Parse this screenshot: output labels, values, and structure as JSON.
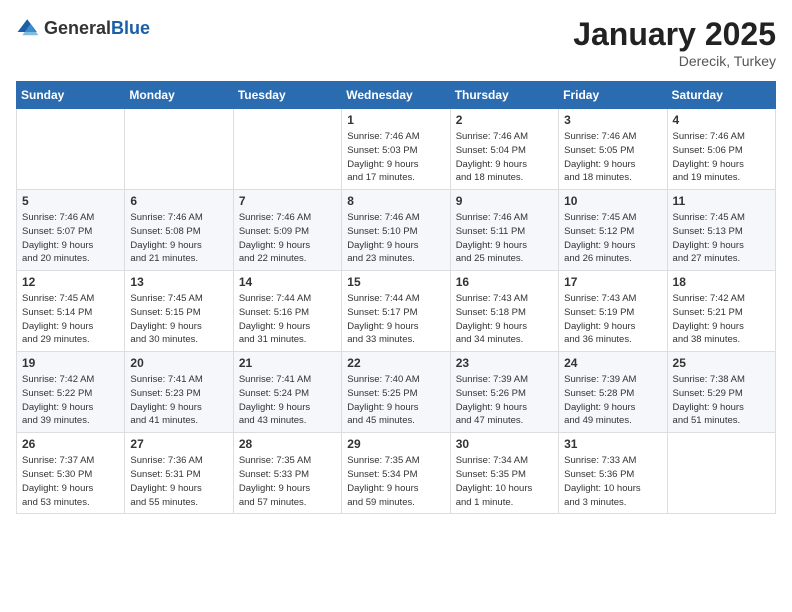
{
  "header": {
    "logo": {
      "general": "General",
      "blue": "Blue"
    },
    "title": "January 2025",
    "location": "Derecik, Turkey"
  },
  "calendar": {
    "weekdays": [
      "Sunday",
      "Monday",
      "Tuesday",
      "Wednesday",
      "Thursday",
      "Friday",
      "Saturday"
    ],
    "weeks": [
      [
        {
          "day": null,
          "info": null
        },
        {
          "day": null,
          "info": null
        },
        {
          "day": null,
          "info": null
        },
        {
          "day": "1",
          "info": "Sunrise: 7:46 AM\nSunset: 5:03 PM\nDaylight: 9 hours\nand 17 minutes."
        },
        {
          "day": "2",
          "info": "Sunrise: 7:46 AM\nSunset: 5:04 PM\nDaylight: 9 hours\nand 18 minutes."
        },
        {
          "day": "3",
          "info": "Sunrise: 7:46 AM\nSunset: 5:05 PM\nDaylight: 9 hours\nand 18 minutes."
        },
        {
          "day": "4",
          "info": "Sunrise: 7:46 AM\nSunset: 5:06 PM\nDaylight: 9 hours\nand 19 minutes."
        }
      ],
      [
        {
          "day": "5",
          "info": "Sunrise: 7:46 AM\nSunset: 5:07 PM\nDaylight: 9 hours\nand 20 minutes."
        },
        {
          "day": "6",
          "info": "Sunrise: 7:46 AM\nSunset: 5:08 PM\nDaylight: 9 hours\nand 21 minutes."
        },
        {
          "day": "7",
          "info": "Sunrise: 7:46 AM\nSunset: 5:09 PM\nDaylight: 9 hours\nand 22 minutes."
        },
        {
          "day": "8",
          "info": "Sunrise: 7:46 AM\nSunset: 5:10 PM\nDaylight: 9 hours\nand 23 minutes."
        },
        {
          "day": "9",
          "info": "Sunrise: 7:46 AM\nSunset: 5:11 PM\nDaylight: 9 hours\nand 25 minutes."
        },
        {
          "day": "10",
          "info": "Sunrise: 7:45 AM\nSunset: 5:12 PM\nDaylight: 9 hours\nand 26 minutes."
        },
        {
          "day": "11",
          "info": "Sunrise: 7:45 AM\nSunset: 5:13 PM\nDaylight: 9 hours\nand 27 minutes."
        }
      ],
      [
        {
          "day": "12",
          "info": "Sunrise: 7:45 AM\nSunset: 5:14 PM\nDaylight: 9 hours\nand 29 minutes."
        },
        {
          "day": "13",
          "info": "Sunrise: 7:45 AM\nSunset: 5:15 PM\nDaylight: 9 hours\nand 30 minutes."
        },
        {
          "day": "14",
          "info": "Sunrise: 7:44 AM\nSunset: 5:16 PM\nDaylight: 9 hours\nand 31 minutes."
        },
        {
          "day": "15",
          "info": "Sunrise: 7:44 AM\nSunset: 5:17 PM\nDaylight: 9 hours\nand 33 minutes."
        },
        {
          "day": "16",
          "info": "Sunrise: 7:43 AM\nSunset: 5:18 PM\nDaylight: 9 hours\nand 34 minutes."
        },
        {
          "day": "17",
          "info": "Sunrise: 7:43 AM\nSunset: 5:19 PM\nDaylight: 9 hours\nand 36 minutes."
        },
        {
          "day": "18",
          "info": "Sunrise: 7:42 AM\nSunset: 5:21 PM\nDaylight: 9 hours\nand 38 minutes."
        }
      ],
      [
        {
          "day": "19",
          "info": "Sunrise: 7:42 AM\nSunset: 5:22 PM\nDaylight: 9 hours\nand 39 minutes."
        },
        {
          "day": "20",
          "info": "Sunrise: 7:41 AM\nSunset: 5:23 PM\nDaylight: 9 hours\nand 41 minutes."
        },
        {
          "day": "21",
          "info": "Sunrise: 7:41 AM\nSunset: 5:24 PM\nDaylight: 9 hours\nand 43 minutes."
        },
        {
          "day": "22",
          "info": "Sunrise: 7:40 AM\nSunset: 5:25 PM\nDaylight: 9 hours\nand 45 minutes."
        },
        {
          "day": "23",
          "info": "Sunrise: 7:39 AM\nSunset: 5:26 PM\nDaylight: 9 hours\nand 47 minutes."
        },
        {
          "day": "24",
          "info": "Sunrise: 7:39 AM\nSunset: 5:28 PM\nDaylight: 9 hours\nand 49 minutes."
        },
        {
          "day": "25",
          "info": "Sunrise: 7:38 AM\nSunset: 5:29 PM\nDaylight: 9 hours\nand 51 minutes."
        }
      ],
      [
        {
          "day": "26",
          "info": "Sunrise: 7:37 AM\nSunset: 5:30 PM\nDaylight: 9 hours\nand 53 minutes."
        },
        {
          "day": "27",
          "info": "Sunrise: 7:36 AM\nSunset: 5:31 PM\nDaylight: 9 hours\nand 55 minutes."
        },
        {
          "day": "28",
          "info": "Sunrise: 7:35 AM\nSunset: 5:33 PM\nDaylight: 9 hours\nand 57 minutes."
        },
        {
          "day": "29",
          "info": "Sunrise: 7:35 AM\nSunset: 5:34 PM\nDaylight: 9 hours\nand 59 minutes."
        },
        {
          "day": "30",
          "info": "Sunrise: 7:34 AM\nSunset: 5:35 PM\nDaylight: 10 hours\nand 1 minute."
        },
        {
          "day": "31",
          "info": "Sunrise: 7:33 AM\nSunset: 5:36 PM\nDaylight: 10 hours\nand 3 minutes."
        },
        {
          "day": null,
          "info": null
        }
      ]
    ]
  }
}
